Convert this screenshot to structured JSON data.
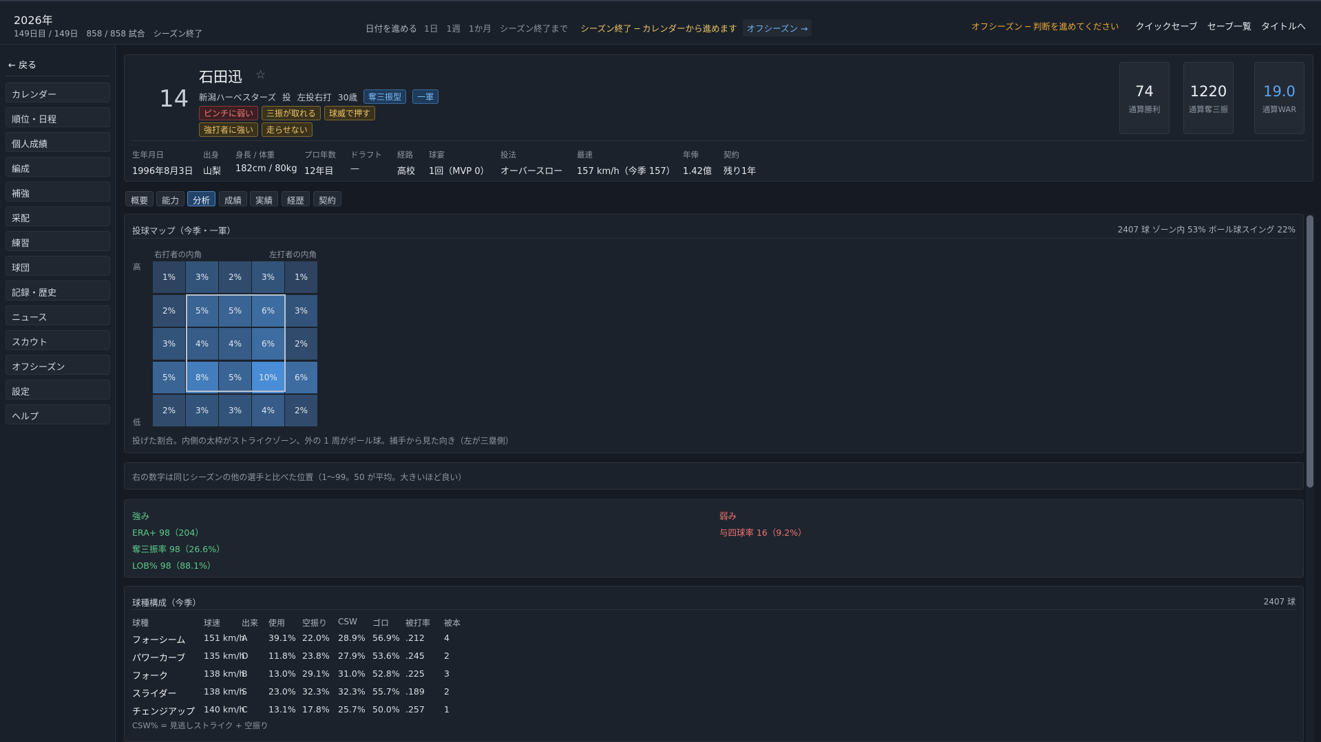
{
  "topbar": {
    "year": "2026年",
    "sub": "149日目 / 149日　858 / 858 試合　シーズン終了",
    "advance_label": "日付を進める",
    "advance_options": [
      "1日",
      "1週",
      "1か月",
      "シーズン終了まで"
    ],
    "season_warning": "シーズン終了 ─ カレンダーから進めます",
    "offseason_button": "オフシーズン →",
    "right_warning": "オフシーズン ─ 判断を進めてください",
    "quick_save": "クイックセーブ",
    "save_list": "セーブ一覧",
    "to_title": "タイトルへ"
  },
  "sidebar": {
    "back": "← 戻る",
    "items": [
      "カレンダー",
      "順位・日程",
      "個人成績",
      "編成",
      "補強",
      "采配",
      "練習",
      "球団",
      "記録・歴史",
      "ニュース",
      "スカウト",
      "オフシーズン",
      "設定",
      "ヘルプ"
    ]
  },
  "player": {
    "number": "14",
    "name": "石田迅",
    "star": "☆",
    "team": "新潟ハーベスターズ",
    "position": "投",
    "throws_bats": "左投右打",
    "age": "30歳",
    "badges": [
      "奪三振型",
      "一軍"
    ],
    "traits_row1": [
      "ピンチに弱い",
      "三振が取れる",
      "球威で押す"
    ],
    "traits_row2": [
      "強打者に強い",
      "走らせない"
    ],
    "stats": [
      {
        "value": "74",
        "label": "通算勝利"
      },
      {
        "value": "1220",
        "label": "通算奪三振"
      },
      {
        "value": "19.0",
        "label": "通算WAR"
      }
    ],
    "info": [
      {
        "key": "生年月日",
        "value": "1996年8月3日"
      },
      {
        "key": "出身",
        "value": "山梨"
      },
      {
        "key": "身長 / 体重",
        "value": "182cm / 80kg"
      },
      {
        "key": "プロ年数",
        "value": "12年目"
      },
      {
        "key": "ドラフト",
        "value": "—"
      },
      {
        "key": "経路",
        "value": "高校"
      },
      {
        "key": "球宴",
        "value": "1回（MVP 0）"
      },
      {
        "key": "投法",
        "value": "オーバースロー"
      },
      {
        "key": "最速",
        "value": "157 km/h（今季 157）"
      },
      {
        "key": "年俸",
        "value": "1.42億"
      },
      {
        "key": "契約",
        "value": "残り1年"
      }
    ]
  },
  "tabs": [
    "概要",
    "能力",
    "分析",
    "成績",
    "実績",
    "経歴",
    "契約"
  ],
  "active_tab": "分析",
  "pitch_map": {
    "title": "投球マップ（今季・一軍）",
    "summary": "2407 球  ゾーン内 53%  ボール球スイング 22%",
    "label_right_inside": "右打者の内角",
    "label_left_inside": "左打者の内角",
    "label_high": "高",
    "label_low": "低",
    "cells": [
      [
        "1%",
        "3%",
        "2%",
        "3%",
        "1%"
      ],
      [
        "2%",
        "5%",
        "5%",
        "6%",
        "3%"
      ],
      [
        "3%",
        "4%",
        "4%",
        "6%",
        "2%"
      ],
      [
        "5%",
        "8%",
        "5%",
        "10%",
        "6%"
      ],
      [
        "2%",
        "3%",
        "3%",
        "4%",
        "2%"
      ]
    ],
    "values": [
      [
        1,
        3,
        2,
        3,
        1
      ],
      [
        2,
        5,
        5,
        6,
        3
      ],
      [
        3,
        4,
        4,
        6,
        2
      ],
      [
        5,
        8,
        5,
        10,
        6
      ],
      [
        2,
        3,
        3,
        4,
        2
      ]
    ],
    "note": "投げた割合。内側の太枠がストライクゾーン、外の 1 周がボール球。捕手から見た向き（左が三塁側）"
  },
  "percentile_note": "右の数字は同じシーズンの他の選手と比べた位置（1〜99。50 が平均。大きいほど良い）",
  "strengths": {
    "title": "強み",
    "items": [
      "ERA+ 98（204）",
      "奪三振率 98（26.6%）",
      "LOB% 98（88.1%）"
    ]
  },
  "weaknesses": {
    "title": "弱み",
    "items": [
      "与四球率 16（9.2%）"
    ]
  },
  "pitch_mix": {
    "title": "球種構成（今季）",
    "total": "2407 球",
    "headers": [
      "球種",
      "球速",
      "出来",
      "使用",
      "空振り",
      "CSW",
      "ゴロ",
      "被打率",
      "被本"
    ],
    "rows": [
      [
        "フォーシーム",
        "151 km/h",
        "A",
        "39.1%",
        "22.0%",
        "28.9%",
        "56.9%",
        ".212",
        "4"
      ],
      [
        "パワーカーブ",
        "135 km/h",
        "D",
        "11.8%",
        "23.8%",
        "27.9%",
        "53.6%",
        ".245",
        "2"
      ],
      [
        "フォーク",
        "138 km/h",
        "B",
        "13.0%",
        "29.1%",
        "31.0%",
        "52.8%",
        ".225",
        "3"
      ],
      [
        "スライダー",
        "138 km/h",
        "S",
        "23.0%",
        "32.3%",
        "32.3%",
        "55.7%",
        ".189",
        "2"
      ],
      [
        "チェンジアップ",
        "140 km/h",
        "C",
        "13.1%",
        "17.8%",
        "25.7%",
        "50.0%",
        ".257",
        "1"
      ]
    ],
    "footnote": "CSW% = 見逃しストライク + 空振り"
  },
  "colors": {
    "accent": "#4c86c3",
    "strength": "#5ec98a",
    "weakness": "#f07470",
    "warning": "#e8c46a"
  }
}
